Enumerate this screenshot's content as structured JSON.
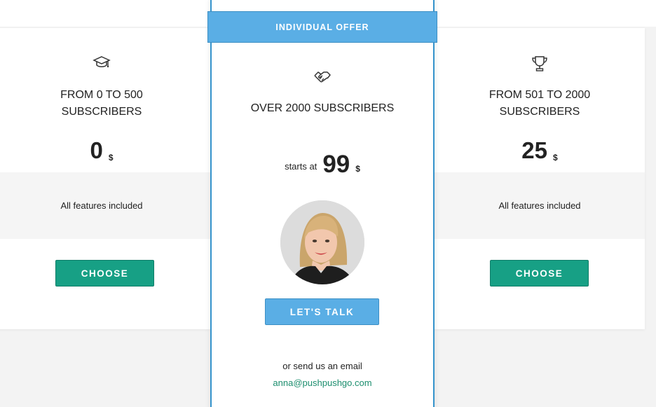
{
  "plans": {
    "left": {
      "icon": "graduation-cap-icon",
      "heading_line1": "FROM 0 TO 500",
      "heading_line2": "SUBSCRIBERS",
      "price": "0",
      "currency": "$",
      "features": "All features included",
      "button": "CHOOSE"
    },
    "featured": {
      "ribbon": "INDIVIDUAL OFFER",
      "icon": "handshake-icon",
      "heading": "OVER 2000 SUBSCRIBERS",
      "price_prefix": "starts at",
      "price": "99",
      "currency": "$",
      "button": "LET'S TALK",
      "or_text": "or send us an email",
      "email": "anna@pushpushgo.com"
    },
    "right": {
      "icon": "trophy-icon",
      "heading_line1": "FROM 501 TO 2000",
      "heading_line2": "SUBSCRIBERS",
      "price": "25",
      "currency": "$",
      "features": "All features included",
      "button": "CHOOSE"
    }
  },
  "colors": {
    "choose_button": "#17a085",
    "featured_accent": "#5aaee5",
    "featured_border": "#3593cc",
    "email_link": "#1c8e6e"
  }
}
